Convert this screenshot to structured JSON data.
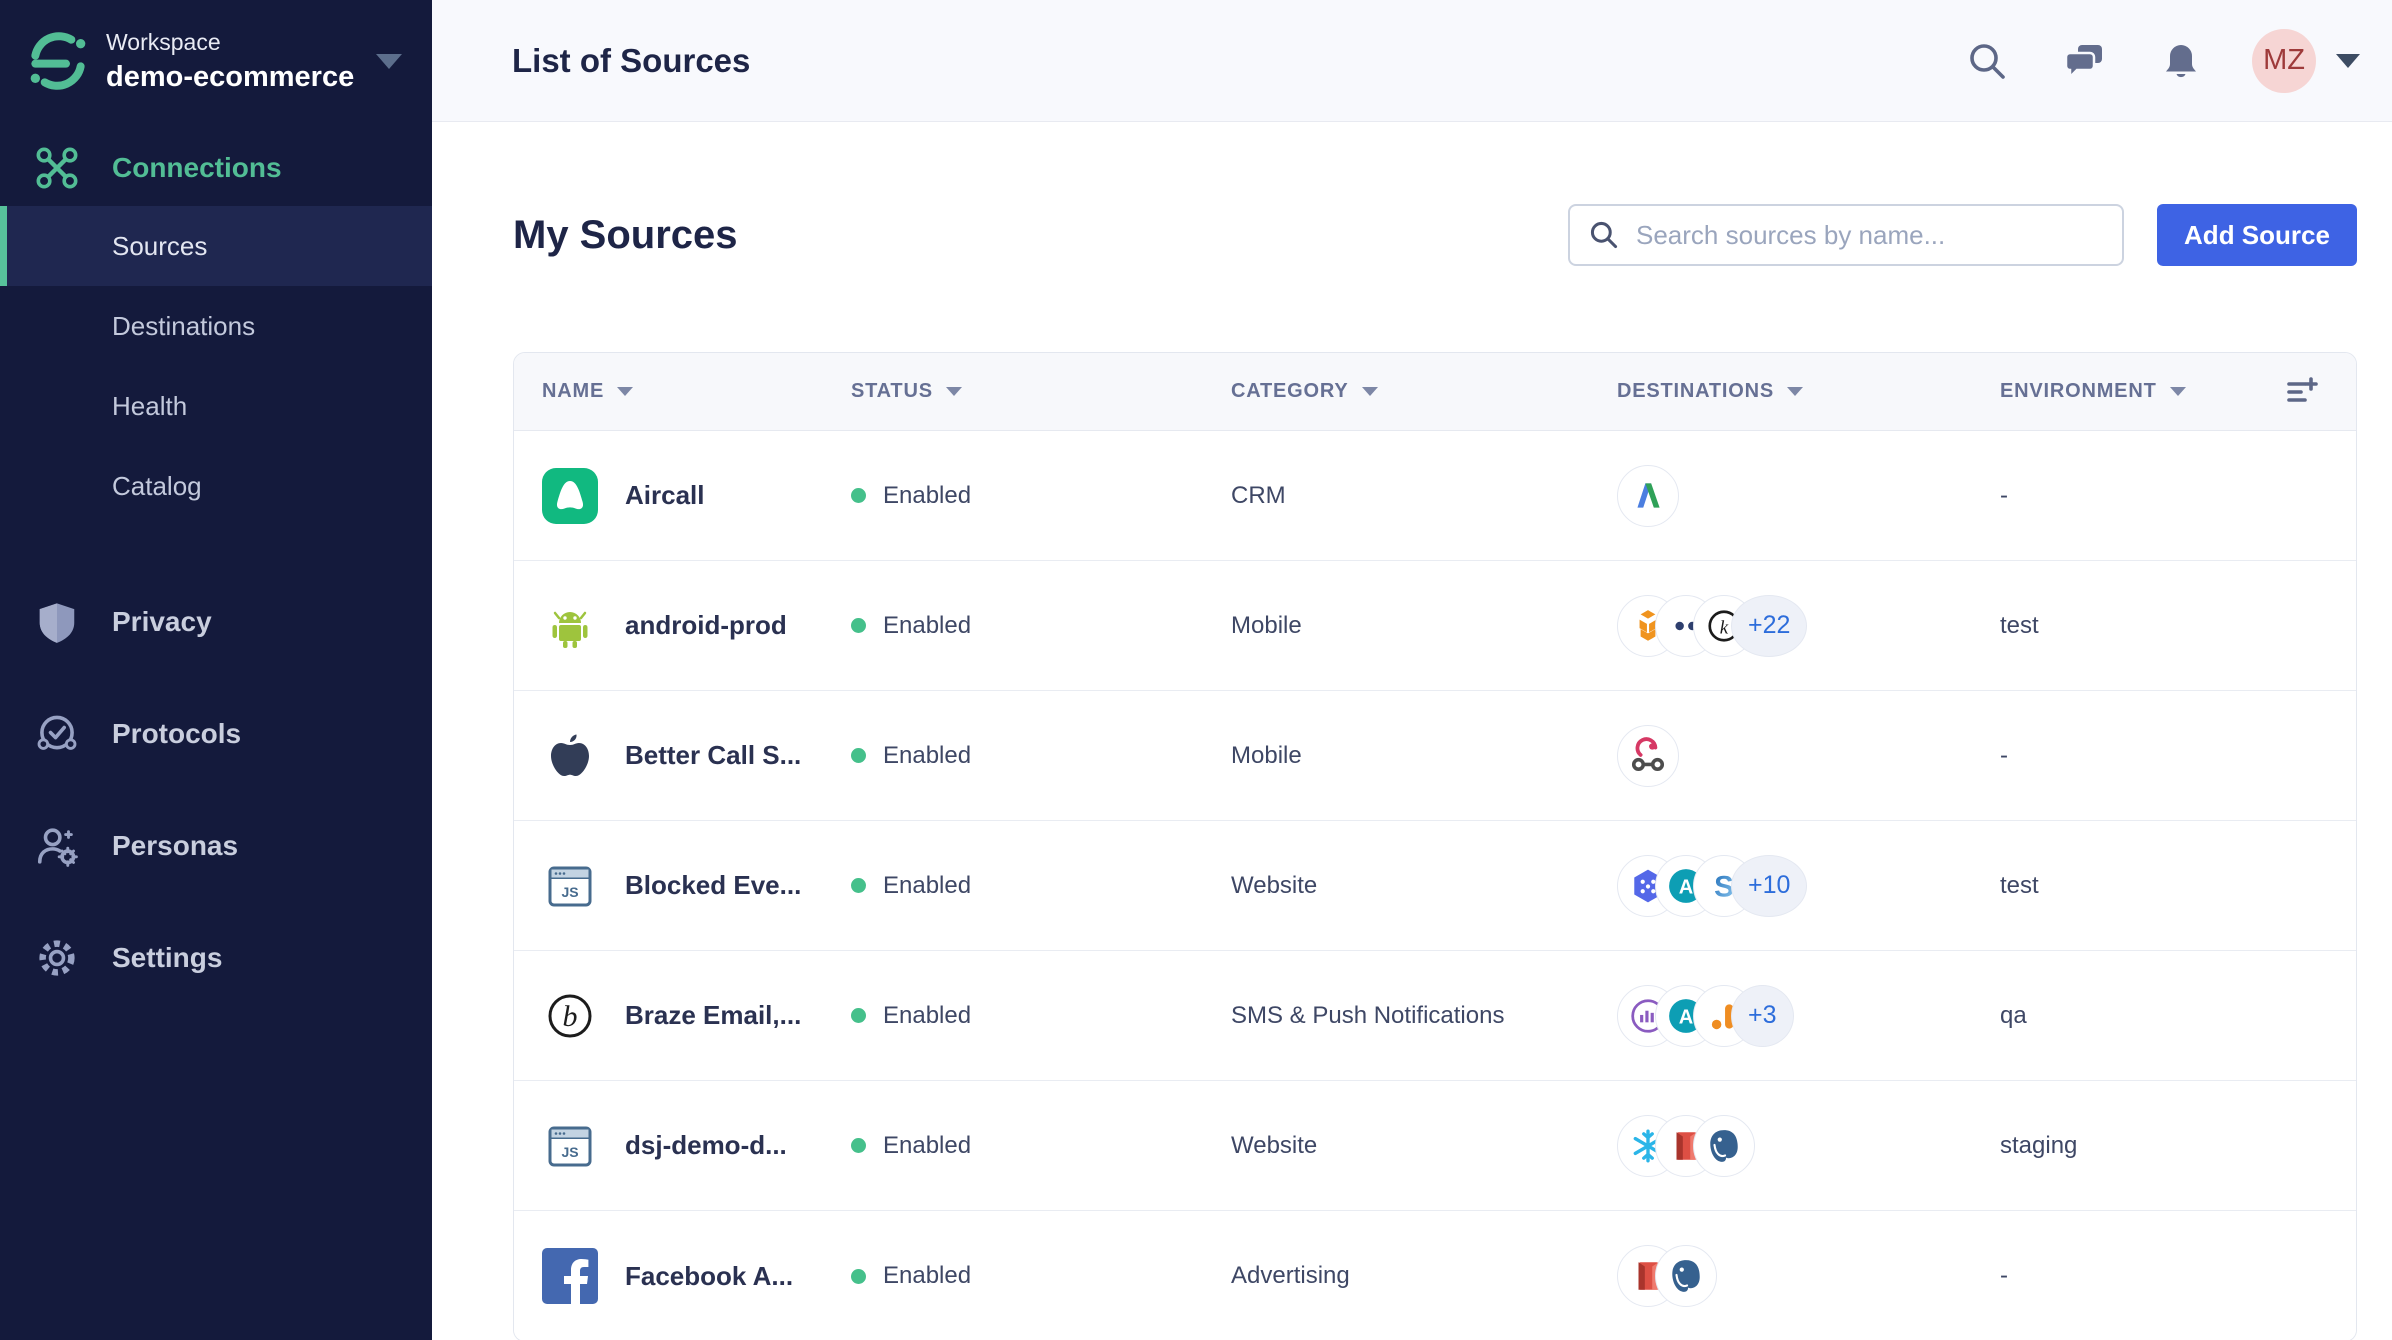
{
  "colors": {
    "accent_green": "#52bd95",
    "sidebar_bg": "#141a3c",
    "button_blue": "#3e63e4",
    "status_dot_green": "#45c08b",
    "avatar_bg": "#f6d5d4",
    "avatar_text": "#9e3a3a"
  },
  "sidebar": {
    "workspace_label": "Workspace",
    "workspace_name": "demo-ecommerce",
    "connections_label": "Connections",
    "sub_items": [
      {
        "label": "Sources",
        "active": true
      },
      {
        "label": "Destinations",
        "active": false
      },
      {
        "label": "Health",
        "active": false
      },
      {
        "label": "Catalog",
        "active": false
      }
    ],
    "section_items": [
      {
        "label": "Privacy"
      },
      {
        "label": "Protocols"
      },
      {
        "label": "Personas"
      },
      {
        "label": "Settings"
      }
    ]
  },
  "topbar": {
    "title": "List of Sources",
    "avatar_initials": "MZ"
  },
  "toolbar": {
    "heading": "My Sources",
    "search_placeholder": "Search sources by name...",
    "add_button_label": "Add Source"
  },
  "table": {
    "headers": [
      "NAME",
      "STATUS",
      "CATEGORY",
      "DESTINATIONS",
      "ENVIRONMENT"
    ],
    "rows": [
      {
        "name": "Aircall",
        "source_icon": "aircall",
        "status": "Enabled",
        "category": "CRM",
        "destinations": {
          "icons": [
            "adwords"
          ],
          "more": ""
        },
        "environment": "-"
      },
      {
        "name": "android-prod",
        "source_icon": "android",
        "status": "Enabled",
        "category": "Mobile",
        "destinations": {
          "icons": [
            "aws",
            "dots",
            "k-circle"
          ],
          "more": "+22"
        },
        "environment": "test"
      },
      {
        "name": "Better Call S...",
        "source_icon": "apple",
        "status": "Enabled",
        "category": "Mobile",
        "destinations": {
          "icons": [
            "webhook"
          ],
          "more": ""
        },
        "environment": "-"
      },
      {
        "name": "Blocked Eve...",
        "source_icon": "js-browser",
        "status": "Enabled",
        "category": "Website",
        "destinations": {
          "icons": [
            "hex-dots",
            "teal-a",
            "s-flag"
          ],
          "more": "+10"
        },
        "environment": "test"
      },
      {
        "name": "Braze Email,...",
        "source_icon": "braze",
        "status": "Enabled",
        "category": "SMS & Push Notifications",
        "destinations": {
          "icons": [
            "purple-chart",
            "teal-a",
            "ga-orange"
          ],
          "more": "+3"
        },
        "environment": "qa"
      },
      {
        "name": "dsj-demo-d...",
        "source_icon": "js-browser",
        "status": "Enabled",
        "category": "Website",
        "destinations": {
          "icons": [
            "snowflake",
            "redshift",
            "postgres"
          ],
          "more": ""
        },
        "environment": "staging"
      },
      {
        "name": "Facebook A...",
        "source_icon": "facebook",
        "status": "Enabled",
        "category": "Advertising",
        "destinations": {
          "icons": [
            "redshift",
            "postgres"
          ],
          "more": ""
        },
        "environment": "-"
      }
    ]
  }
}
